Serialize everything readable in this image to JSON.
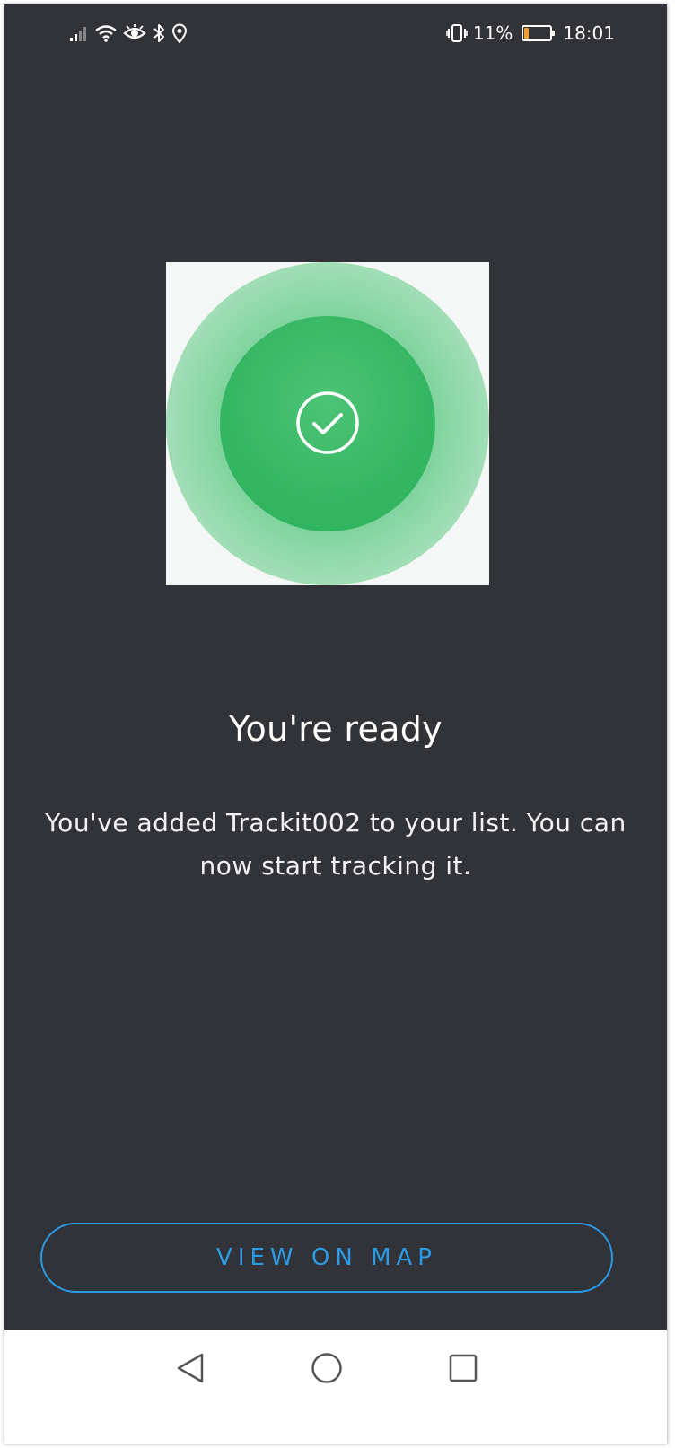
{
  "status_bar": {
    "battery_percent": "11%",
    "battery_level": 0.11,
    "time": "18:01",
    "icons_left": [
      "signal-icon",
      "wifi-icon",
      "eye-icon",
      "bluetooth-icon",
      "location-icon"
    ],
    "icons_right": [
      "vibrate-icon",
      "battery-icon"
    ],
    "battery_color": "#f0a030"
  },
  "content": {
    "title": "You're ready",
    "message": "You've added Trackit002 to your list. You can now start tracking it.",
    "success_color": "#2bb05a"
  },
  "actions": {
    "view_on_map_label": "VIEW ON MAP",
    "accent_color": "#2a9be6"
  },
  "nav_bar": {
    "buttons": [
      "back-icon",
      "home-icon",
      "recents-icon"
    ]
  }
}
